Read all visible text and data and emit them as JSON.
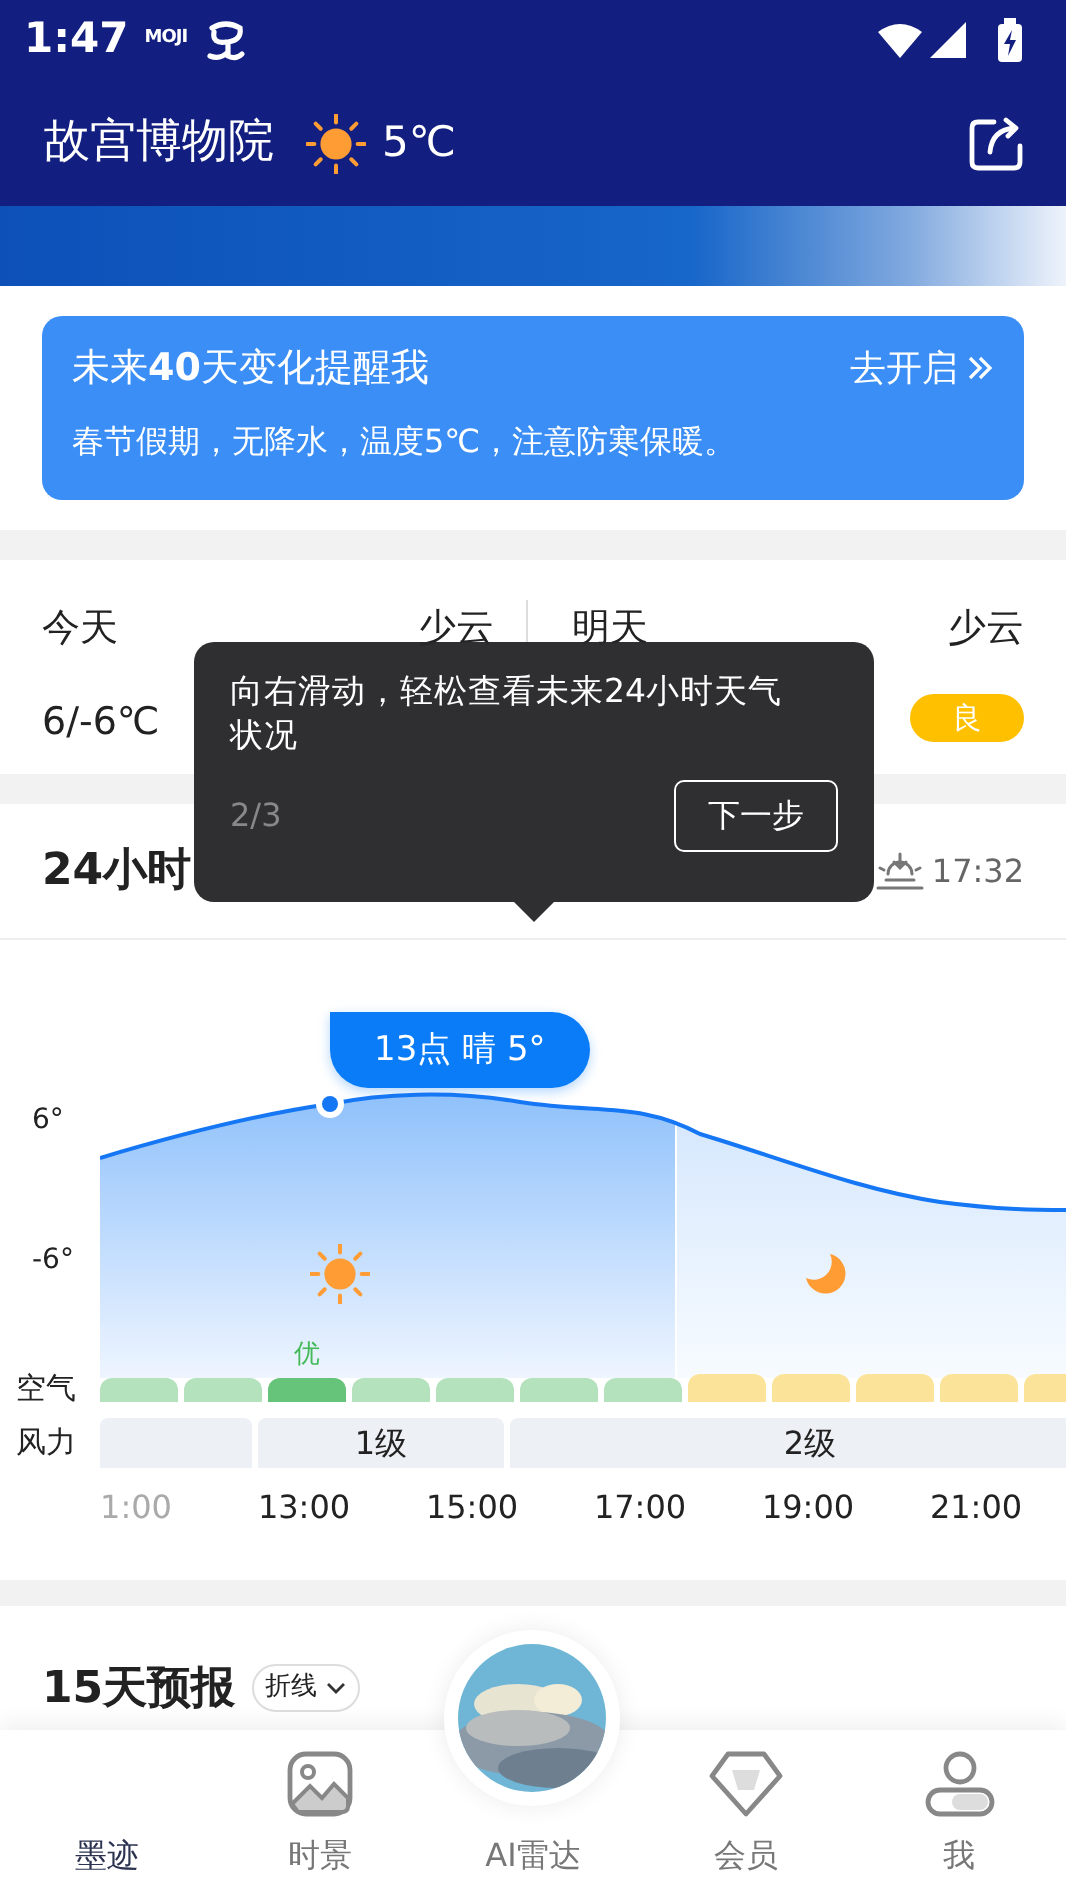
{
  "status_bar": {
    "time": "1:47",
    "brand": "MOJI"
  },
  "header": {
    "location": "故宫博物院",
    "temperature": "5℃"
  },
  "reminder": {
    "title": "未来**40**天变化提醒我",
    "action": "去开启",
    "message": "春节假期，无降水，温度5℃，注意防寒保暖。"
  },
  "days": [
    {
      "label": "今天",
      "condition": "少云",
      "range": "6/-6℃"
    },
    {
      "label": "明天",
      "condition": "少云",
      "aqi": "良",
      "color": "#ffc000"
    }
  ],
  "forecast_24h": {
    "title": "24小时",
    "sunset": "17:32",
    "bubble": "13点 晴 5°",
    "y_labels": [
      "6°",
      "-6°"
    ],
    "air_label": "空气",
    "wind_label": "风力",
    "air": [
      {
        "kind": "good",
        "selected": false
      },
      {
        "kind": "good",
        "selected": false
      },
      {
        "kind": "good",
        "selected": true,
        "label": "优"
      },
      {
        "kind": "good",
        "selected": false
      },
      {
        "kind": "good",
        "selected": false
      },
      {
        "kind": "good",
        "selected": false
      },
      {
        "kind": "good",
        "selected": false
      },
      {
        "kind": "moderate",
        "selected": false
      },
      {
        "kind": "moderate",
        "selected": false
      },
      {
        "kind": "moderate",
        "selected": false
      },
      {
        "kind": "moderate",
        "selected": false
      },
      {
        "kind": "moderate",
        "selected": false
      }
    ],
    "wind": [
      "1级",
      "2级"
    ],
    "times": [
      {
        "text": "1:00",
        "dimmed": true
      },
      {
        "text": "13:00",
        "dimmed": false
      },
      {
        "text": "15:00",
        "dimmed": false
      },
      {
        "text": "17:00",
        "dimmed": false
      },
      {
        "text": "19:00",
        "dimmed": false
      },
      {
        "text": "21:00",
        "dimmed": false
      }
    ]
  },
  "guide": {
    "text": "向右滑动，轻松查看未来24小时天气状况",
    "step": "2/3",
    "button": "下一步"
  },
  "forecast_15d": {
    "title": "15天预报",
    "mode": "折线"
  },
  "nav": [
    {
      "kind": "home",
      "label": "墨迹",
      "selected": true
    },
    {
      "kind": "picture",
      "label": "时景",
      "selected": false
    },
    {
      "kind": "radar",
      "label": "AI雷达",
      "selected": false
    },
    {
      "kind": "vip",
      "label": "会员",
      "selected": false
    },
    {
      "kind": "profile",
      "label": "我",
      "selected": false
    }
  ]
}
